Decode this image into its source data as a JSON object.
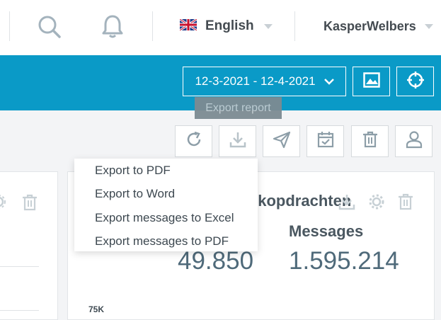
{
  "topbar": {
    "icons": [
      "search-icon",
      "bell-icon"
    ],
    "language": {
      "flag": "uk-flag-icon",
      "label": "English"
    },
    "user": {
      "name": "KasperWelbers"
    }
  },
  "toolbar": {
    "date_range": "12-3-2021 - 12-4-2021",
    "buttons": [
      "image-icon",
      "crosshair-icon"
    ],
    "tooltip": "Export report",
    "actions": [
      "refresh-icon",
      "download-icon",
      "send-icon",
      "calendar-check-icon",
      "trash-icon",
      "user-icon"
    ]
  },
  "export_menu": {
    "items": [
      "Export to PDF",
      "Export to Word",
      "Export messages to Excel",
      "Export messages to PDF"
    ]
  },
  "widget": {
    "title_fragment": "ekopdrachten",
    "metric_label": "Messages",
    "value_left": "49.850",
    "value_right": "1.595.214",
    "axis_tick": "75K"
  },
  "colors": {
    "accent": "#0a9ac7",
    "tooltip_bg": "#7d8b92"
  }
}
